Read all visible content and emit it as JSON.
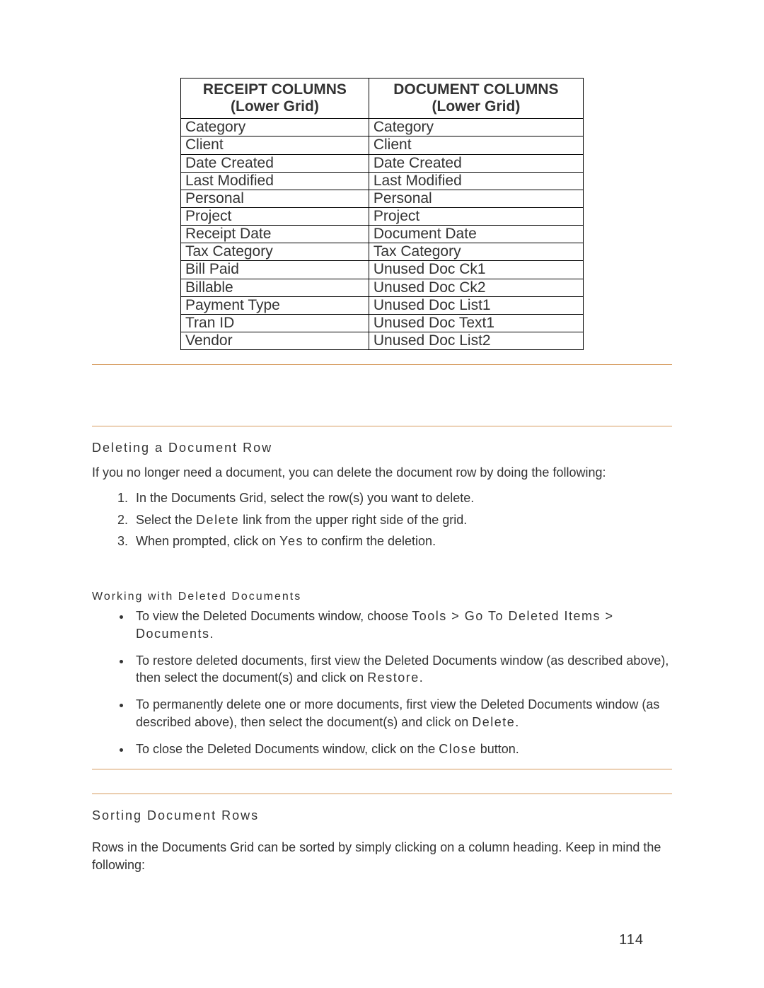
{
  "chart_data": {
    "type": "table",
    "headers": [
      {
        "main": "RECEIPT COLUMNS",
        "sub": "(Lower Grid)"
      },
      {
        "main": "DOCUMENT COLUMNS",
        "sub": "(Lower Grid)"
      }
    ],
    "rows": [
      [
        "Category",
        "Category"
      ],
      [
        "Client",
        "Client"
      ],
      [
        "Date Created",
        "Date Created"
      ],
      [
        "Last Modified",
        "Last Modified"
      ],
      [
        "Personal",
        "Personal"
      ],
      [
        "Project",
        "Project"
      ],
      [
        "Receipt Date",
        "Document Date"
      ],
      [
        "Tax Category",
        "Tax Category"
      ],
      [
        "Bill Paid",
        "Unused Doc Ck1"
      ],
      [
        "Billable",
        "Unused Doc Ck2"
      ],
      [
        "Payment Type",
        "Unused Doc List1"
      ],
      [
        "Tran ID",
        "Unused Doc Text1"
      ],
      [
        "Vendor",
        "Unused Doc List2"
      ]
    ]
  },
  "sections": {
    "deleting": {
      "heading": "Deleting a Document Row",
      "intro": "If you no longer need a document, you can delete the document row by doing the following:",
      "steps": [
        {
          "pre": "In the Documents Grid, select the row(s) you want to delete."
        },
        {
          "pre": "Select the ",
          "strong": "Delete",
          "post": " link from the upper right side of the grid."
        },
        {
          "pre": "When prompted, click on ",
          "strong": "Yes",
          "post": " to confirm the deletion."
        }
      ]
    },
    "working": {
      "heading": "Working with Deleted Documents",
      "bullets": [
        {
          "pre": "To view the Deleted Documents window, choose ",
          "strong": "Tools > Go To Deleted Items > Documents",
          "post": "."
        },
        {
          "pre": "To restore deleted documents, first view the Deleted Documents window (as described above), then select the document(s) and click on ",
          "strong": "Restore",
          "post": "."
        },
        {
          "pre": "To permanently delete one or more documents, first view the Deleted Documents window (as described above), then select the document(s) and click on ",
          "strong": "Delete",
          "post": "."
        },
        {
          "pre": "To close the Deleted Documents window, click on the ",
          "strong": "Close",
          "post": " button."
        }
      ]
    },
    "sorting": {
      "heading": "Sorting Document Rows",
      "intro": "Rows in the Documents Grid can be sorted by simply clicking on a column heading. Keep in mind the following:"
    }
  },
  "page_number": "114"
}
